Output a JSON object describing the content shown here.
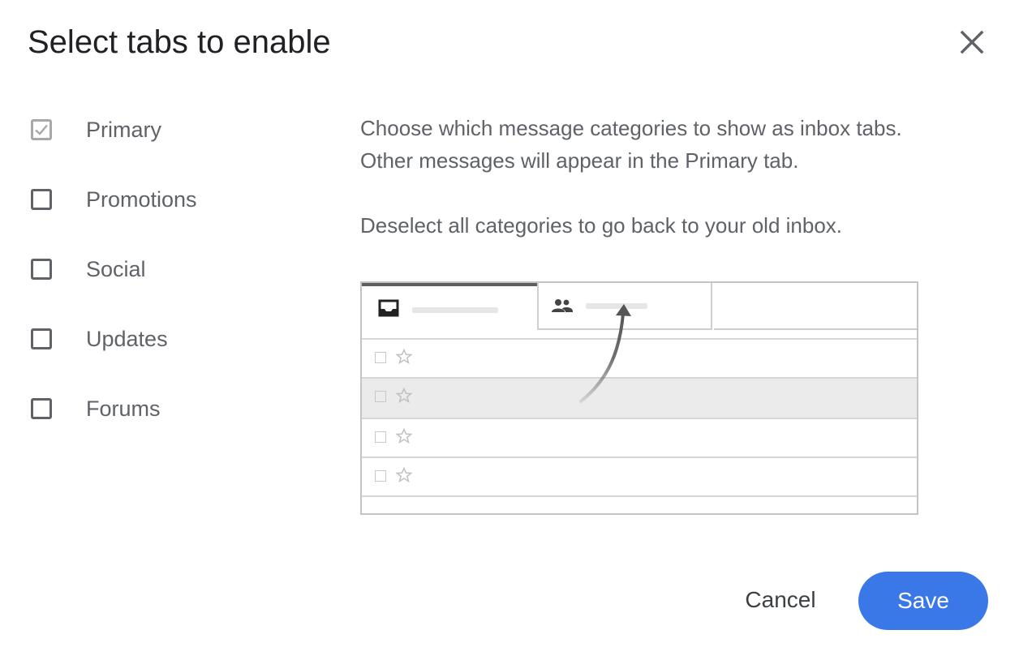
{
  "dialog": {
    "title": "Select tabs to enable",
    "close_icon": "close-icon"
  },
  "options": [
    {
      "label": "Primary",
      "checked": true,
      "disabled": true
    },
    {
      "label": "Promotions",
      "checked": false,
      "disabled": false
    },
    {
      "label": "Social",
      "checked": false,
      "disabled": false
    },
    {
      "label": "Updates",
      "checked": false,
      "disabled": false
    },
    {
      "label": "Forums",
      "checked": false,
      "disabled": false
    }
  ],
  "description": {
    "line1": "Choose which message categories to show as inbox tabs. Other messages will appear in the Primary tab.",
    "line2": "Deselect all categories to go back to your old inbox."
  },
  "illustration": {
    "tab1_icon": "inbox-icon",
    "tab2_icon": "people-icon",
    "row_icons": [
      "checkbox-icon",
      "star-icon"
    ],
    "arrow_icon": "curved-arrow-icon"
  },
  "actions": {
    "cancel_label": "Cancel",
    "save_label": "Save"
  },
  "colors": {
    "primary_button": "#3b78e7",
    "text_secondary": "#5f6368"
  }
}
